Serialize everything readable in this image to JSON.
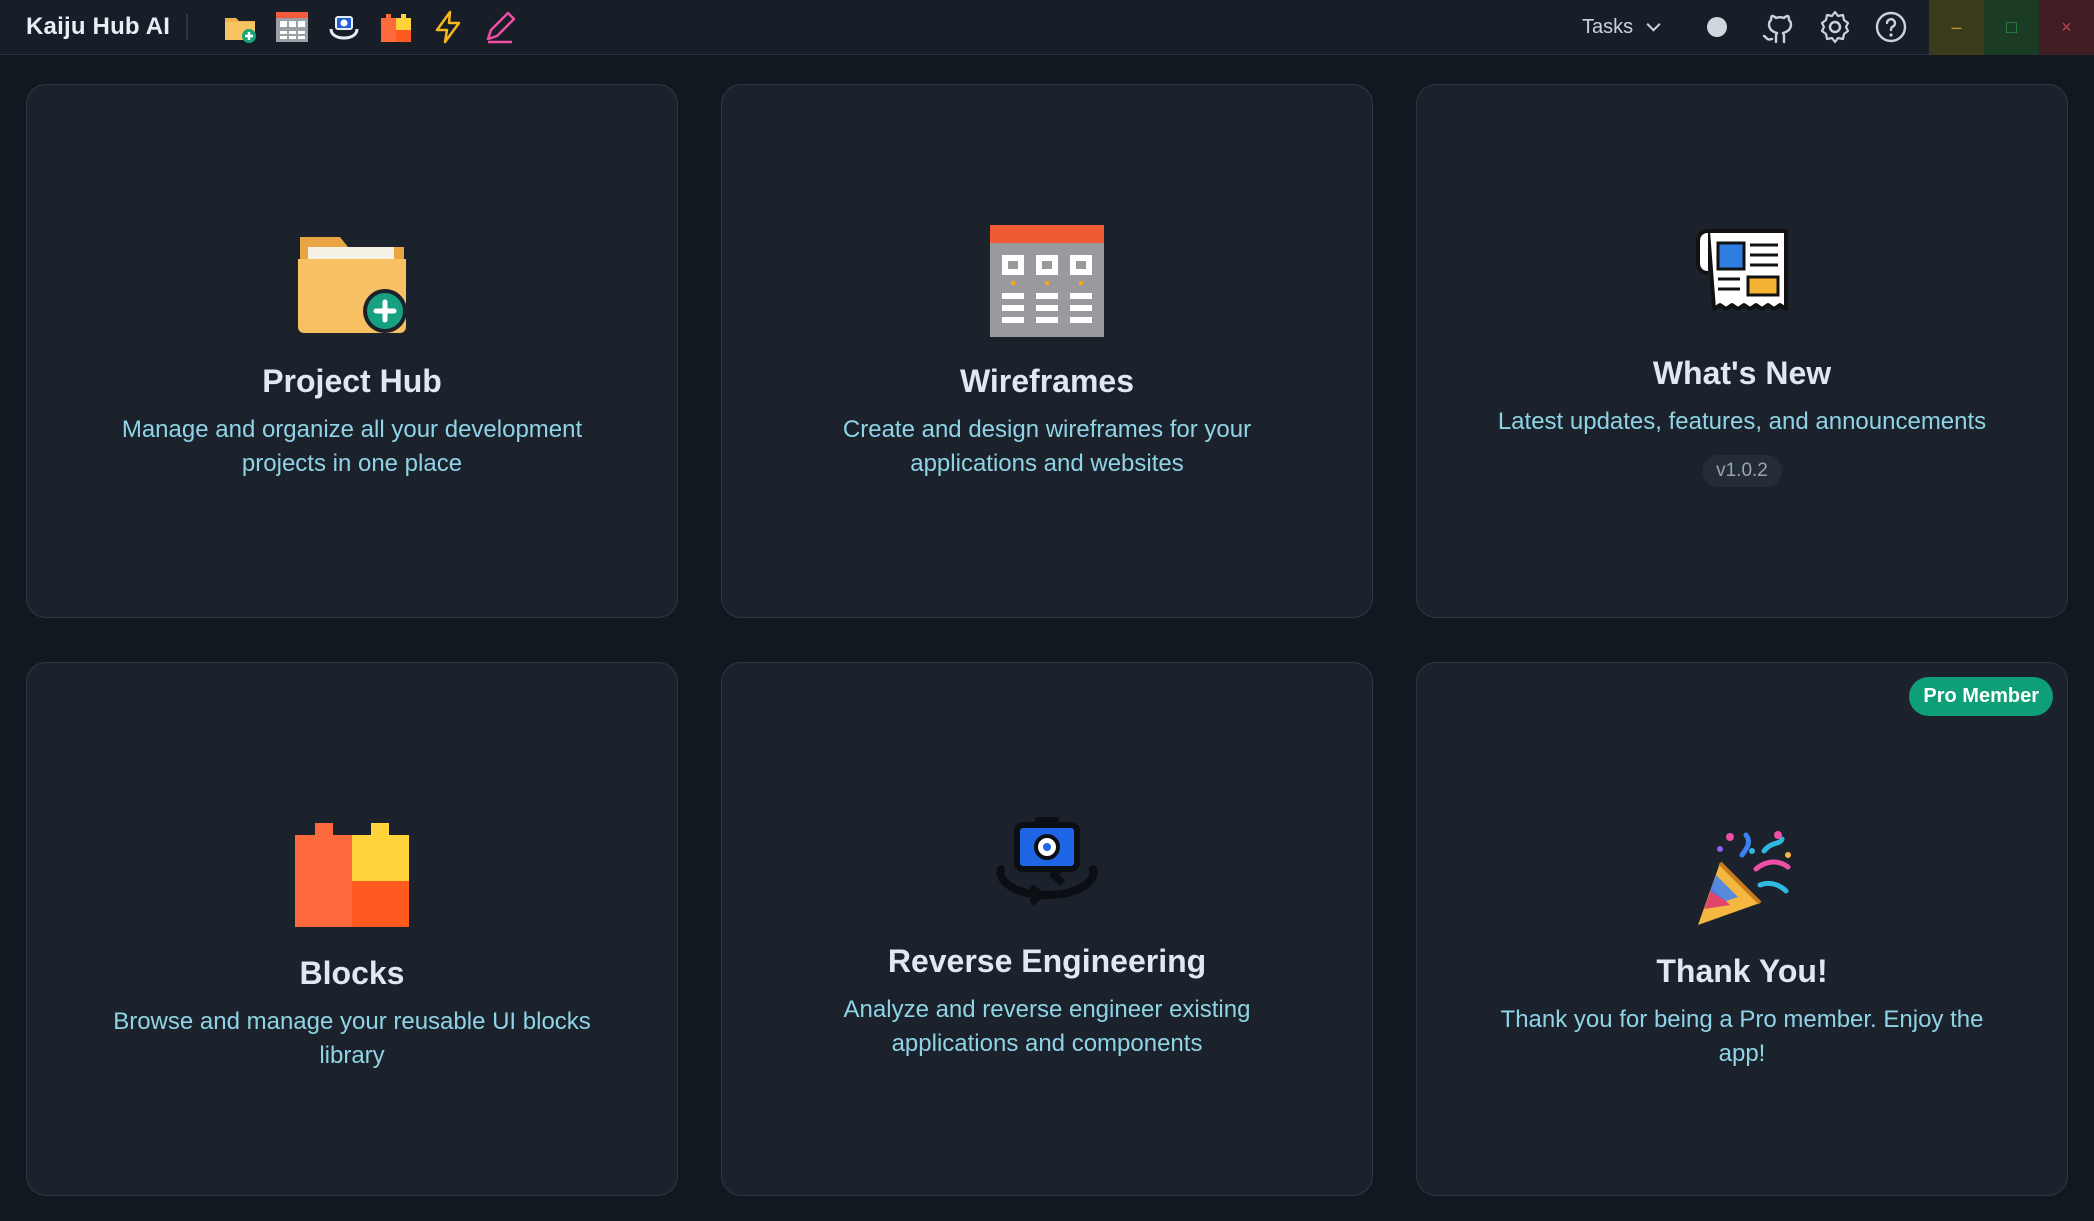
{
  "app": {
    "title": "Kaiju Hub AI"
  },
  "toolbar": {
    "icons": [
      "folder-add-icon",
      "wireframe-grid-icon",
      "camera-rotate-icon",
      "blocks-icon",
      "lightning-icon",
      "pencil-icon"
    ]
  },
  "header": {
    "tasks_label": "Tasks",
    "status_icon": "status-dot",
    "github_icon": "github-icon",
    "settings_icon": "gear-icon",
    "help_icon": "help-circle-icon"
  },
  "window_controls": {
    "minimize": "–",
    "maximize": "□",
    "close": "×"
  },
  "colors": {
    "background": "#111820",
    "card": "#1b222b",
    "accent_text": "#8fd4e6",
    "pro_badge": "#0f9f78"
  },
  "cards": [
    {
      "title": "Project Hub",
      "description": "Manage and organize all your development projects in one place",
      "icon": "folder-add-icon"
    },
    {
      "title": "Wireframes",
      "description": "Create and design wireframes for your applications and websites",
      "icon": "wireframe-grid-icon"
    },
    {
      "title": "What's New",
      "description": "Latest updates, features, and announcements",
      "version": "v1.0.2",
      "icon": "newspaper-icon"
    },
    {
      "title": "Blocks",
      "description": "Browse and manage your reusable UI blocks library",
      "icon": "blocks-icon"
    },
    {
      "title": "Reverse Engineering",
      "description": "Analyze and reverse engineer existing applications and components",
      "icon": "camera-rotate-icon"
    },
    {
      "title": "Thank You!",
      "description": "Thank you for being a Pro member. Enjoy the app!",
      "badge": "Pro Member",
      "icon": "party-popper-icon"
    }
  ]
}
